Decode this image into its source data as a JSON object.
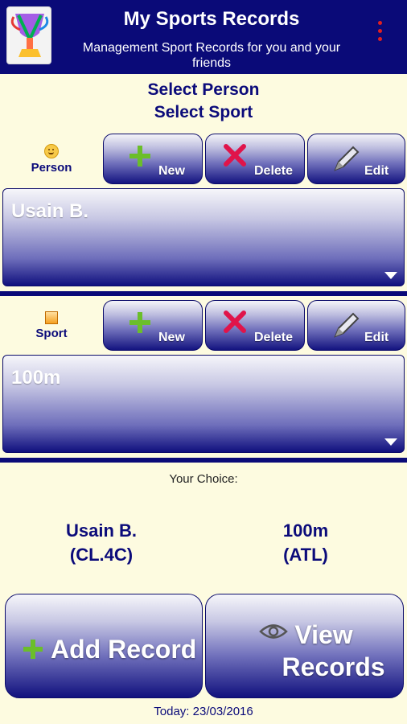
{
  "header": {
    "title": "My Sports Records",
    "subtitle": "Management Sport Records for you and your friends",
    "menu_icon": "overflow-menu-icon",
    "app_icon": "trophy-app-icon",
    "background": "#0A0A78"
  },
  "select": {
    "person_title": "Select Person",
    "sport_title": "Select Sport"
  },
  "person": {
    "label": "Person",
    "icon": "smiley-icon",
    "new_label": "New",
    "delete_label": "Delete",
    "edit_label": "Edit",
    "selected": "Usain B."
  },
  "sport": {
    "label": "Sport",
    "icon": "sport-flag-icon",
    "new_label": "New",
    "delete_label": "Delete",
    "edit_label": "Edit",
    "selected": "100m"
  },
  "choice": {
    "caption": "Your Choice:",
    "person_name": "Usain B.",
    "person_code": "(CL.4C)",
    "sport_name": "100m",
    "sport_code": "(ATL)"
  },
  "actions": {
    "add_record": "Add Record",
    "view_records": "View Records",
    "add_icon": "plus-icon",
    "view_icon": "eye-icon"
  },
  "footer": {
    "today": "Today: 23/03/2016"
  },
  "colors": {
    "background": "#FDFBE0",
    "navy": "#0B0B7A",
    "plus": "#6BBE2A",
    "delete": "#E0144A"
  }
}
